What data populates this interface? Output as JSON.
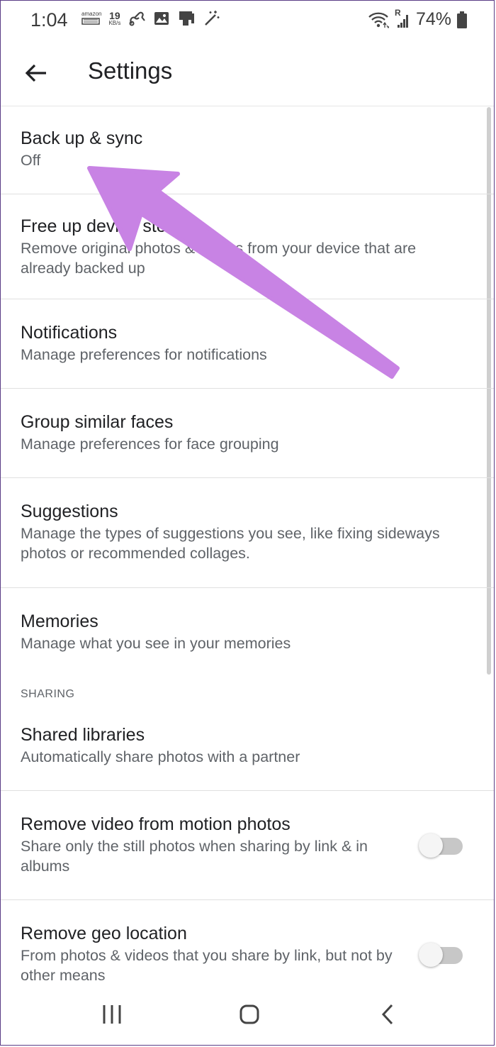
{
  "status_bar": {
    "time": "1:04",
    "net_speed_value": "19",
    "net_speed_unit": "KB/s",
    "amazon_label": "amazon",
    "signal_label": "R",
    "battery_percent": "74%"
  },
  "app_bar": {
    "title": "Settings"
  },
  "settings": {
    "items": [
      {
        "title": "Back up & sync",
        "subtitle": "Off"
      },
      {
        "title": "Free up device storage",
        "subtitle": "Remove original photos & videos from your device that are already backed up"
      },
      {
        "title": "Notifications",
        "subtitle": "Manage preferences for notifications"
      },
      {
        "title": "Group similar faces",
        "subtitle": "Manage preferences for face grouping"
      },
      {
        "title": "Suggestions",
        "subtitle": "Manage the types of suggestions you see, like fixing sideways photos or recommended collages."
      },
      {
        "title": "Memories",
        "subtitle": "Manage what you see in your memories"
      }
    ],
    "section_sharing": "SHARING",
    "sharing_items": [
      {
        "title": "Shared libraries",
        "subtitle": "Automatically share photos with a partner"
      },
      {
        "title": "Remove video from motion photos",
        "subtitle": "Share only the still photos when sharing by link & in albums",
        "toggle_on": false
      },
      {
        "title": "Remove geo location",
        "subtitle": "From photos & videos that you share by link, but not by other means",
        "toggle_on": false
      }
    ]
  },
  "annotation": {
    "arrow_color": "#c883e4"
  },
  "nav_bar": {
    "icons": [
      "recent-apps-icon",
      "home-icon",
      "back-nav-icon"
    ]
  }
}
